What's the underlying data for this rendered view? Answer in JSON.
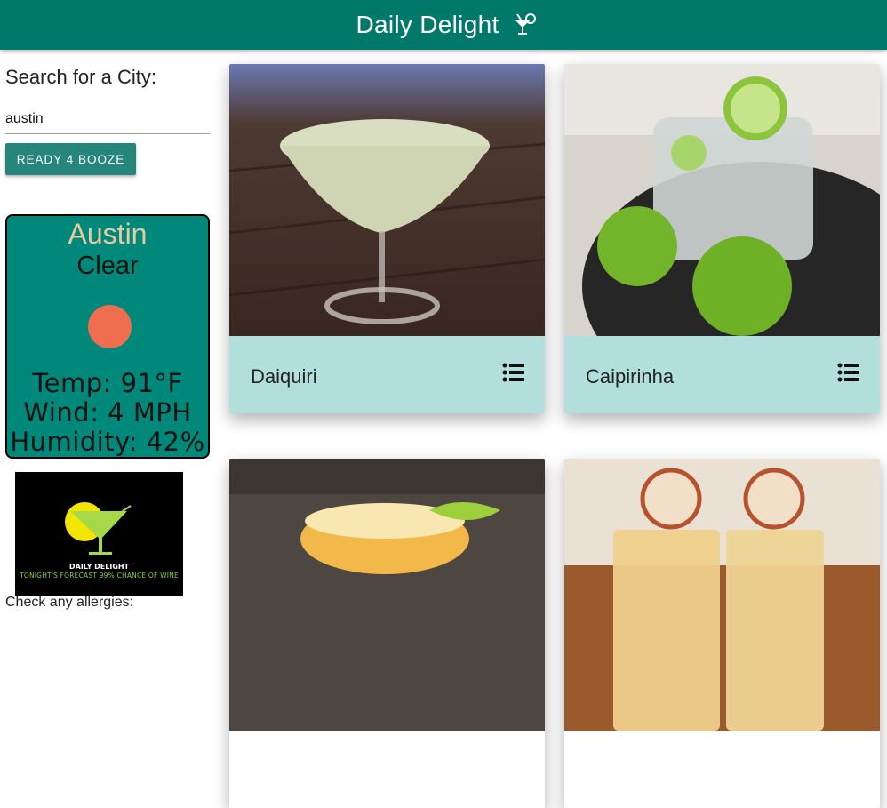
{
  "header": {
    "title": "Daily Delight",
    "icon": "cocktail-icon"
  },
  "sidebar": {
    "search_label": "Search for a City:",
    "city_value": "austin",
    "button_label": "Ready 4 Booze",
    "weather": {
      "city": "Austin",
      "condition": "Clear",
      "icon": "sun-icon",
      "temp": "Temp: 91°F",
      "wind": "Wind: 4 MPH",
      "humidity": "Humidity: 42%"
    },
    "logo": {
      "title": "DAILY DELIGHT",
      "tagline": "TONIGHT'S FORECAST 99% CHANCE OF WINE"
    },
    "allergy_label": "Check any allergies:"
  },
  "drinks": [
    {
      "name": "Daiquiri",
      "icon": "list-icon"
    },
    {
      "name": "Caipirinha",
      "icon": "list-icon"
    },
    {
      "name": "",
      "icon": ""
    },
    {
      "name": "",
      "icon": ""
    }
  ],
  "colors": {
    "header": "#00796b",
    "button": "#26867b",
    "weather_card": "#00897b",
    "card_action": "#b2dfdb",
    "sun": "#ee6e4f"
  }
}
